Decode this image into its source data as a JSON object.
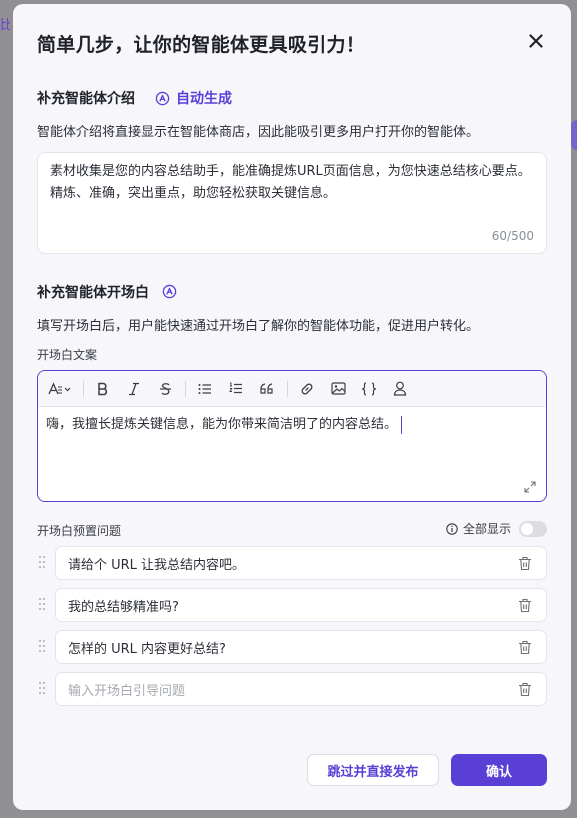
{
  "background": {
    "left_fragment": "比"
  },
  "modal": {
    "title": "简单几步，让你的智能体更具吸引力！",
    "intro_section": {
      "title": "补充智能体介绍",
      "auto_generate": "自动生成",
      "description": "智能体介绍将直接显示在智能体商店，因此能吸引更多用户打开你的智能体。",
      "value": "素材收集是您的内容总结助手，能准确提炼URL页面信息，为您快速总结核心要点。精炼、准确，突出重点，助您轻松获取关键信息。",
      "count": "60/500"
    },
    "opening_section": {
      "title": "补充智能体开场白",
      "description": "填写开场白后，用户能快速通过开场白了解你的智能体功能，促进用户转化。",
      "copy_label": "开场白文案",
      "editor_value": "嗨，我擅长提炼关键信息，能为你带来简洁明了的内容总结。",
      "questions_label": "开场白预置问题",
      "show_all": "全部显示",
      "questions": [
        "请给个 URL 让我总结内容吧。",
        "我的总结够精准吗?",
        "怎样的 URL 内容更好总结?"
      ],
      "question_placeholder": "输入开场白引导问题"
    },
    "footer": {
      "skip_label": "跳过并直接发布",
      "confirm_label": "确认"
    }
  },
  "colors": {
    "accent": "#5a3fd6",
    "overlay": "#8f8f94",
    "modal_bg": "#f6f6fb"
  },
  "icons": {
    "close": "close-icon",
    "ai": "ai-spark-icon",
    "toolbar": [
      "font-size-icon",
      "bold-icon",
      "italic-icon",
      "strikethrough-icon",
      "bullet-list-icon",
      "numbered-list-icon",
      "quote-icon",
      "link-icon",
      "image-icon",
      "code-braces-icon",
      "user-icon"
    ],
    "expand": "expand-icon",
    "info": "info-icon",
    "drag": "drag-handle-icon",
    "trash": "trash-icon"
  }
}
